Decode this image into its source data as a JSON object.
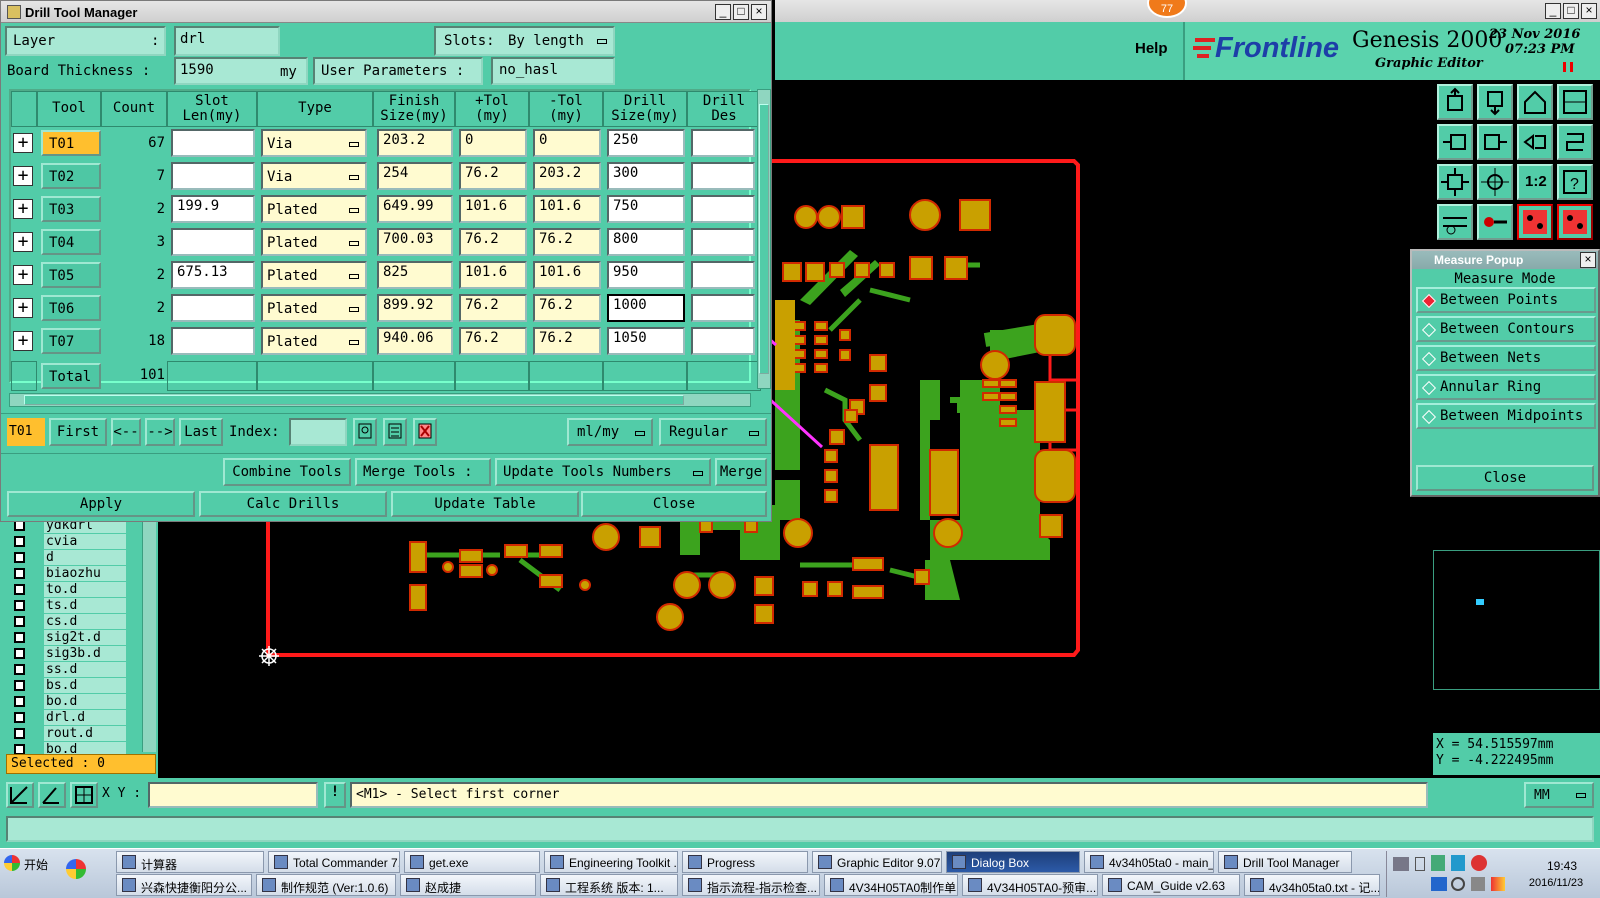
{
  "drill_window": {
    "title": "Drill Tool Manager",
    "layer_label": "Layer",
    "layer_colon": ":",
    "layer_value": "drl",
    "slots_label": "Slots:",
    "slots_value": "By length",
    "board_thickness_label": "Board Thickness :",
    "board_thickness_value": "1590",
    "board_thickness_unit": "my",
    "user_params_label": "User Parameters :",
    "user_params_value": "no_hasl",
    "columns": [
      "Tool",
      "Count",
      "Slot Len(my)",
      "Type",
      "Finish Size(my)",
      "+Tol (my)",
      "-Tol (my)",
      "Drill Size(my)",
      "Drill Des"
    ],
    "col_slot_1": "Slot",
    "col_slot_2": "Len(my)",
    "col_finish_1": "Finish",
    "col_finish_2": "Size(my)",
    "col_ptol_1": "+Tol",
    "col_ptol_2": "(my)",
    "col_ntol_1": "-Tol",
    "col_ntol_2": "(my)",
    "col_drill_1": "Drill",
    "col_drill_2": "Size(my)",
    "col_des_1": "Drill",
    "col_des_2": "Des",
    "rows": [
      {
        "tool": "T01",
        "count": "67",
        "slot": "",
        "type": "Via",
        "finish": "203.2",
        "ptol": "0",
        "ntol": "0",
        "drill": "250"
      },
      {
        "tool": "T02",
        "count": "7",
        "slot": "",
        "type": "Via",
        "finish": "254",
        "ptol": "76.2",
        "ntol": "203.2",
        "drill": "300"
      },
      {
        "tool": "T03",
        "count": "2",
        "slot": "199.9",
        "type": "Plated",
        "finish": "649.99",
        "ptol": "101.6",
        "ntol": "101.6",
        "drill": "750"
      },
      {
        "tool": "T04",
        "count": "3",
        "slot": "",
        "type": "Plated",
        "finish": "700.03",
        "ptol": "76.2",
        "ntol": "76.2",
        "drill": "800"
      },
      {
        "tool": "T05",
        "count": "2",
        "slot": "675.13",
        "type": "Plated",
        "finish": "825",
        "ptol": "101.6",
        "ntol": "101.6",
        "drill": "950"
      },
      {
        "tool": "T06",
        "count": "2",
        "slot": "",
        "type": "Plated",
        "finish": "899.92",
        "ptol": "76.2",
        "ntol": "76.2",
        "drill": "1000"
      },
      {
        "tool": "T07",
        "count": "18",
        "slot": "",
        "type": "Plated",
        "finish": "940.06",
        "ptol": "76.2",
        "ntol": "76.2",
        "drill": "1050"
      }
    ],
    "total_label": "Total",
    "total_count": "101",
    "nav": {
      "current": "T01",
      "first": "First",
      "prev": "<--",
      "next": "-->",
      "last": "Last",
      "index_label": "Index:",
      "units": "ml/my",
      "mode": "Regular"
    },
    "actions1": {
      "combine": "Combine Tools",
      "merge_tools": "Merge Tools :",
      "update_numbers": "Update Tools Numbers",
      "merge": "Merge"
    },
    "actions2": {
      "apply": "Apply",
      "calc": "Calc Drills",
      "update_table": "Update Table",
      "close": "Close"
    }
  },
  "editor": {
    "help": "Help",
    "brand": "Frontline",
    "product": "Genesis 2000",
    "subtitle": "Graphic Editor",
    "date": "23 Nov 2016",
    "time": "07:23 PM",
    "badge": "77"
  },
  "measure_popup": {
    "title": "Measure Popup",
    "heading": "Measure Mode",
    "options": [
      "Between Points",
      "Between Contours",
      "Between Nets",
      "Annular Ring",
      "Between Midpoints"
    ],
    "selected_index": 0,
    "close": "Close"
  },
  "layers_list": {
    "items": [
      "ydkdrl",
      "cvia",
      "d",
      "biaozhu",
      "to.d",
      "ts.d",
      "cs.d",
      "sig2t.d",
      "sig3b.d",
      "ss.d",
      "bs.d",
      "bo.d",
      "drl.d",
      "rout.d",
      "bo.d"
    ],
    "selected_label": "Selected : 0"
  },
  "coords": {
    "x": "X = 54.515597mm",
    "y": "Y = -4.222495mm"
  },
  "status": {
    "xy_label": "X Y :",
    "message": "<M1> - Select first corner",
    "units": "MM"
  },
  "taskbar": {
    "start": "开始",
    "row1": [
      "计算器",
      "Total Commander 7....",
      "get.exe",
      "Engineering Toolkit ...",
      "Progress",
      "Graphic Editor 9.07...",
      "Dialog Box",
      "4v34h05ta0 - main_qa",
      "Drill Tool Manager"
    ],
    "row2": [
      "兴森快捷衡阳分公...",
      "制作规范 (Ver:1.0.6)",
      "赵成捷",
      "工程系统  版本: 1...",
      "指示流程-指示检查...",
      "4V34H05TA0制作单...",
      "4V34H05TA0-预审...",
      "CAM_Guide v2.63",
      "4v34h05ta0.txt - 记..."
    ],
    "clock_time": "19:43",
    "clock_date": "2016/11/23"
  },
  "colors": {
    "accent": "#52cca8",
    "copper": "#c9a000",
    "board_outline": "#ff1a1a",
    "arrow": "#ff33ff"
  }
}
